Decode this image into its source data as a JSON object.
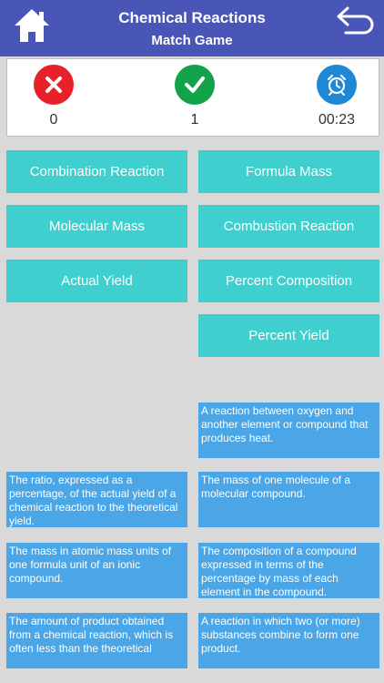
{
  "header": {
    "title": "Chemical Reactions",
    "subtitle": "Match Game"
  },
  "scores": {
    "wrong": "0",
    "correct": "1",
    "timer": "00:23"
  },
  "terms_left": [
    "Combination Reaction",
    "Molecular Mass",
    "Actual Yield"
  ],
  "terms_right": [
    "Formula Mass",
    "Combustion Reaction",
    "Percent Composition",
    "Percent Yield"
  ],
  "definitions_left": [
    "The ratio, expressed as a percentage, of the actual yield of a chemical reaction to the theoretical yield.",
    "The mass in atomic mass units of one formula unit of an ionic compound.",
    "The amount of product obtained from a chemical reaction, which is often less than the theoretical"
  ],
  "definitions_right": [
    "A reaction between oxygen and another element or compound that produces heat.",
    "The mass of one molecule of a molecular compound.",
    "The composition of a compound expressed in terms of the percentage by mass of each element in the compound.",
    "A reaction in which two (or more) substances combine to form one product."
  ],
  "colors": {
    "header": "#4a55b8",
    "term": "#3fcfce",
    "definition": "#4aa6e6",
    "wrong": "#e8202a",
    "correct": "#12a34a",
    "timer": "#1e88d6"
  },
  "icons": {
    "home": "home-icon",
    "back": "back-arrow-icon",
    "wrong": "x-icon",
    "correct": "check-icon",
    "timer": "alarm-clock-icon"
  }
}
